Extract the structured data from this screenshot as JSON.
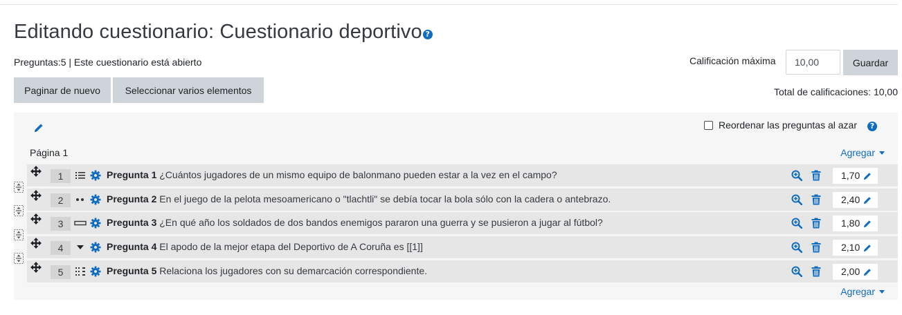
{
  "header": {
    "title": "Editando cuestionario: Cuestionario deportivo",
    "help_glyph": "?",
    "status": "Preguntas:5 | Este cuestionario está abierto"
  },
  "toolbar": {
    "repaginate_label": "Paginar de nuevo",
    "select_multiple_label": "Seleccionar varios elementos"
  },
  "grading": {
    "max_grade_label": "Calificación máxima",
    "max_grade_value": "10,00",
    "save_label": "Guardar",
    "total_label": "Total de calificaciones: 10,00"
  },
  "section": {
    "shuffle_label": "Reordenar las preguntas al azar",
    "shuffle_checked": false,
    "page_label": "Página 1",
    "add_label": "Agregar"
  },
  "questions": [
    {
      "number": "1",
      "type_icon": "multichoice-icon",
      "title": "Pregunta 1",
      "text": "¿Cuántos jugadores de un mismo equipo de balonmano pueden estar a la vez en el campo?",
      "mark": "1,70"
    },
    {
      "number": "2",
      "type_icon": "truefalse-icon",
      "title": "Pregunta 2",
      "text": "En el juego de la pelota mesoamericano o \"tlachtli\" se debía tocar la bola sólo con la cadera o antebrazo.",
      "mark": "2,40"
    },
    {
      "number": "3",
      "type_icon": "shortanswer-icon",
      "title": "Pregunta 3",
      "text": "¿En qué año los soldados de dos bandos enemigos pararon una guerra y se pusieron a jugar al fútbol?",
      "mark": "1,80"
    },
    {
      "number": "4",
      "type_icon": "gapselect-icon",
      "title": "Pregunta 4",
      "text": "El apodo de la mejor etapa del Deportivo de A Coruña es [[1]]",
      "mark": "2,10"
    },
    {
      "number": "5",
      "type_icon": "match-icon",
      "title": "Pregunta 5",
      "text": "Relaciona los jugadores con su demarcación correspondiente.",
      "mark": "2,00"
    }
  ],
  "colors": {
    "link": "#0f6cbf",
    "button_bg": "#ced4da",
    "slot_bg": "#e6e6e6",
    "panel_bg": "#f6f6f6"
  }
}
